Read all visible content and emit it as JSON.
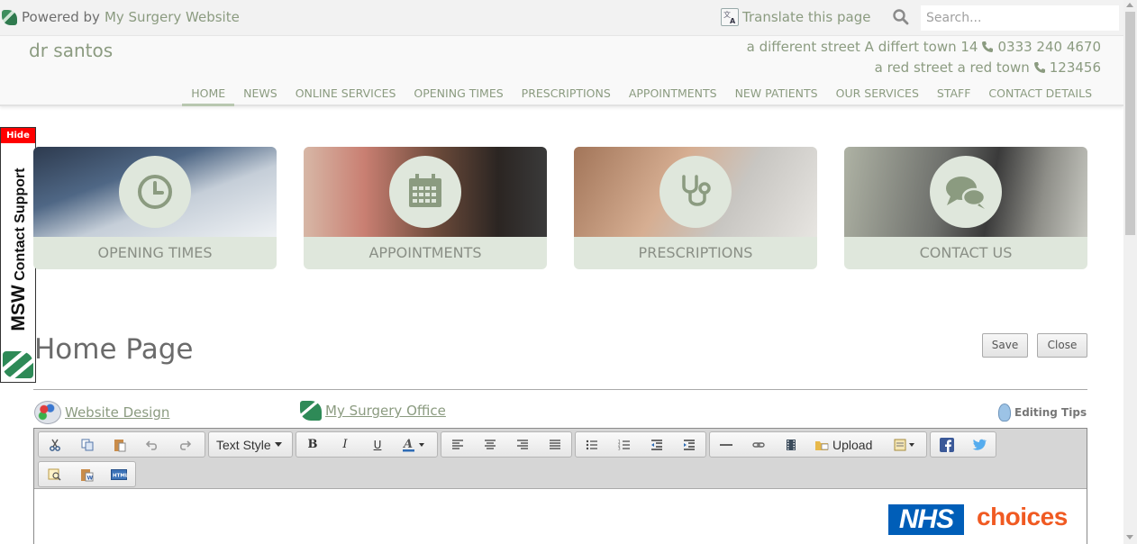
{
  "topbar": {
    "powered_prefix": "Powered by",
    "powered_link": "My Surgery Website",
    "translate": "Translate this page",
    "search_placeholder": "Search..."
  },
  "header": {
    "brand": "dr santos",
    "address1": "a different street A differt town 14",
    "phone1": "0333 240 4670",
    "address2": "a red street a red town",
    "phone2": "123456"
  },
  "nav": {
    "items": [
      "HOME",
      "NEWS",
      "ONLINE SERVICES",
      "OPENING TIMES",
      "PRESCRIPTIONS",
      "APPOINTMENTS",
      "NEW PATIENTS",
      "OUR SERVICES",
      "STAFF",
      "CONTACT DETAILS"
    ],
    "active": "HOME"
  },
  "support": {
    "hide": "Hide",
    "brand": "MSW",
    "label": "Contact Support"
  },
  "tiles": [
    {
      "label": "OPENING TIMES",
      "icon": "clock-icon"
    },
    {
      "label": "APPOINTMENTS",
      "icon": "calendar-icon"
    },
    {
      "label": "PRESCRIPTIONS",
      "icon": "stethoscope-icon"
    },
    {
      "label": "CONTACT US",
      "icon": "chat-bubbles-icon"
    }
  ],
  "page": {
    "title": "Home Page",
    "save": "Save",
    "close": "Close",
    "website_design": "Website Design",
    "surgery_office": "My Surgery Office",
    "editing_tips": "Editing Tips"
  },
  "editor": {
    "text_style": "Text Style",
    "upload": "Upload",
    "toolbar_icons": [
      "cut-icon",
      "copy-icon",
      "paste-icon",
      "undo-icon",
      "redo-icon",
      "bold-icon",
      "italic-icon",
      "underline-icon",
      "text-color-icon",
      "align-left-icon",
      "align-center-icon",
      "align-right-icon",
      "justify-icon",
      "bullet-list-icon",
      "numbered-list-icon",
      "outdent-icon",
      "indent-icon",
      "horizontal-rule-icon",
      "link-icon",
      "video-icon",
      "upload-icon",
      "template-icon",
      "facebook-icon",
      "twitter-icon",
      "find-icon",
      "paste-word-icon",
      "html-source-icon"
    ]
  },
  "content": {
    "nhs": "NHS",
    "choices": "choices"
  },
  "colors": {
    "accent": "#8b9b80",
    "tile_bg": "#dfe7dc",
    "hide_red": "#ff0000",
    "nhs_blue": "#005eb8",
    "choices_orange": "#f05a22"
  }
}
